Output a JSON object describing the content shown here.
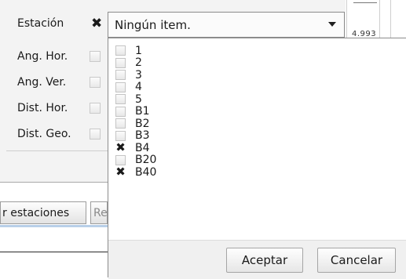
{
  "form": {
    "rows": [
      {
        "label": "Estación",
        "checked": true
      },
      {
        "label": "Ang. Hor.",
        "checked": false
      },
      {
        "label": "Ang. Ver.",
        "checked": false
      },
      {
        "label": "Dist. Hor.",
        "checked": false
      },
      {
        "label": "Dist. Geo.",
        "checked": false
      }
    ]
  },
  "combo": {
    "value": "Ningún item.",
    "icon": "chevron-down-icon"
  },
  "table": {
    "visible_value": "4.993"
  },
  "toolbar": {
    "estaciones_label": "r estaciones",
    "partial_label": "Re"
  },
  "dropdown": {
    "items": [
      {
        "label": "1",
        "checked": false
      },
      {
        "label": "2",
        "checked": false
      },
      {
        "label": "3",
        "checked": false
      },
      {
        "label": "4",
        "checked": false
      },
      {
        "label": "5",
        "checked": false
      },
      {
        "label": "B1",
        "checked": false
      },
      {
        "label": "B2",
        "checked": false
      },
      {
        "label": "B3",
        "checked": false
      },
      {
        "label": "B4",
        "checked": true
      },
      {
        "label": "B20",
        "checked": false
      },
      {
        "label": "B40",
        "checked": true
      }
    ],
    "accept_label": "Aceptar",
    "cancel_label": "Cancelar"
  }
}
